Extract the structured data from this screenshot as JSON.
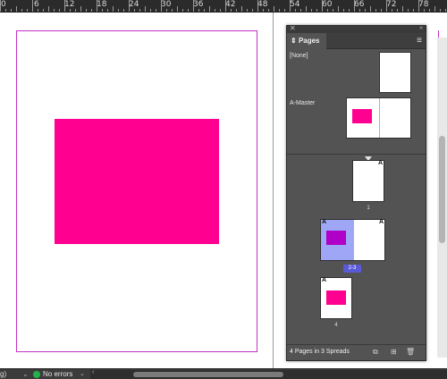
{
  "ruler": {
    "labels": [
      "12",
      "18",
      "24",
      "30",
      "36",
      "42",
      "48",
      "54",
      "60",
      "66",
      "72",
      "78"
    ]
  },
  "colors": {
    "accent": "#ff0090",
    "master_rect": "#ff0090",
    "selected_rect": "#b000c8",
    "selection_highlight": "#9fa6f5",
    "status_ok": "#22b14c"
  },
  "panel": {
    "tab_label": "Pages",
    "none_label": "[None]",
    "master_label": "A-Master",
    "page_letter": "A",
    "pages": [
      {
        "number_label": "1"
      },
      {
        "number_label": "2-3"
      },
      {
        "number_label": "4"
      }
    ],
    "footer_text": "4 Pages in 3 Spreads",
    "icons": [
      "collapse-icon",
      "panel-menu-icon",
      "page-size-icon",
      "new-page-icon",
      "delete-page-icon"
    ]
  },
  "status": {
    "left_text": "g)",
    "errors_text": "No errors"
  }
}
